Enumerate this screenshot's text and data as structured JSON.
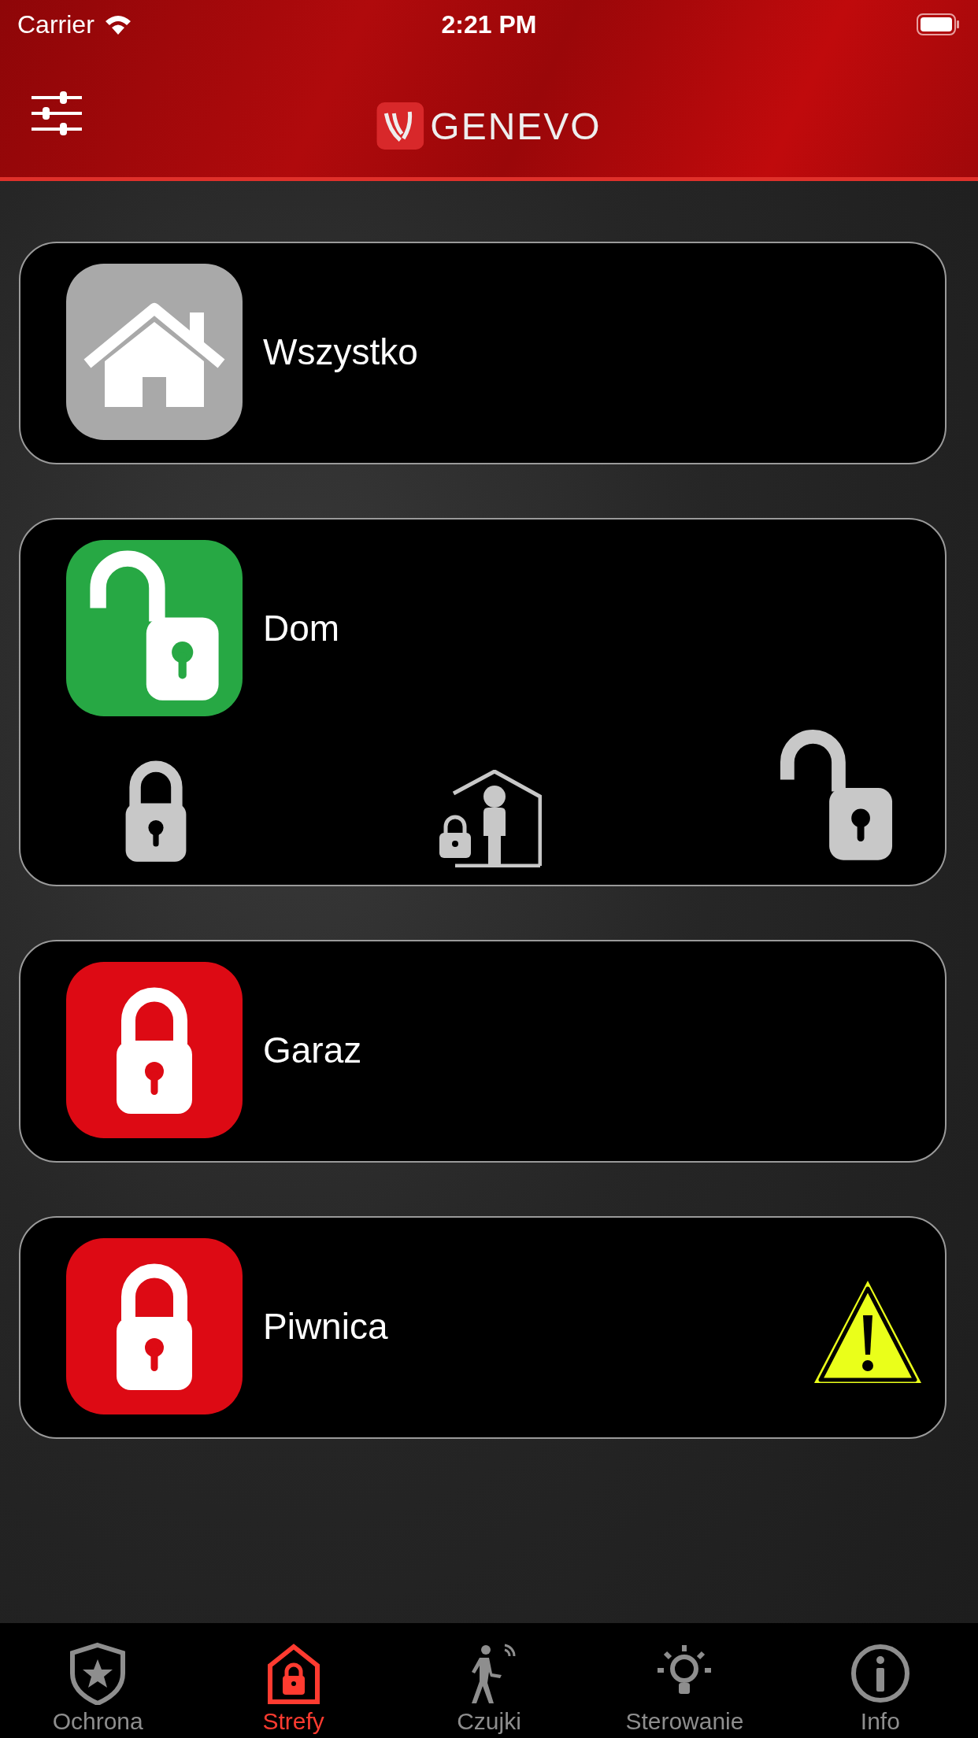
{
  "status_bar": {
    "carrier": "Carrier",
    "time": "2:21 PM"
  },
  "header": {
    "logo": "GENEVO"
  },
  "zones": [
    {
      "name": "Wszystko",
      "kind": "all",
      "warning": false
    },
    {
      "name": "Dom",
      "kind": "disarmed",
      "actions": [
        {
          "kind": "arm"
        },
        {
          "kind": "arm_home"
        },
        {
          "kind": "disarm"
        }
      ],
      "warning": false
    },
    {
      "name": "Garaz",
      "kind": "armed",
      "warning": false
    },
    {
      "name": "Piwnica",
      "kind": "armed",
      "warning": true
    }
  ],
  "tabs": [
    {
      "label": "Ochrona",
      "selected": false
    },
    {
      "label": "Strefy",
      "selected": true
    },
    {
      "label": "Czujki",
      "selected": false
    },
    {
      "label": "Sterowanie",
      "selected": false
    },
    {
      "label": "Info",
      "selected": false
    }
  ]
}
